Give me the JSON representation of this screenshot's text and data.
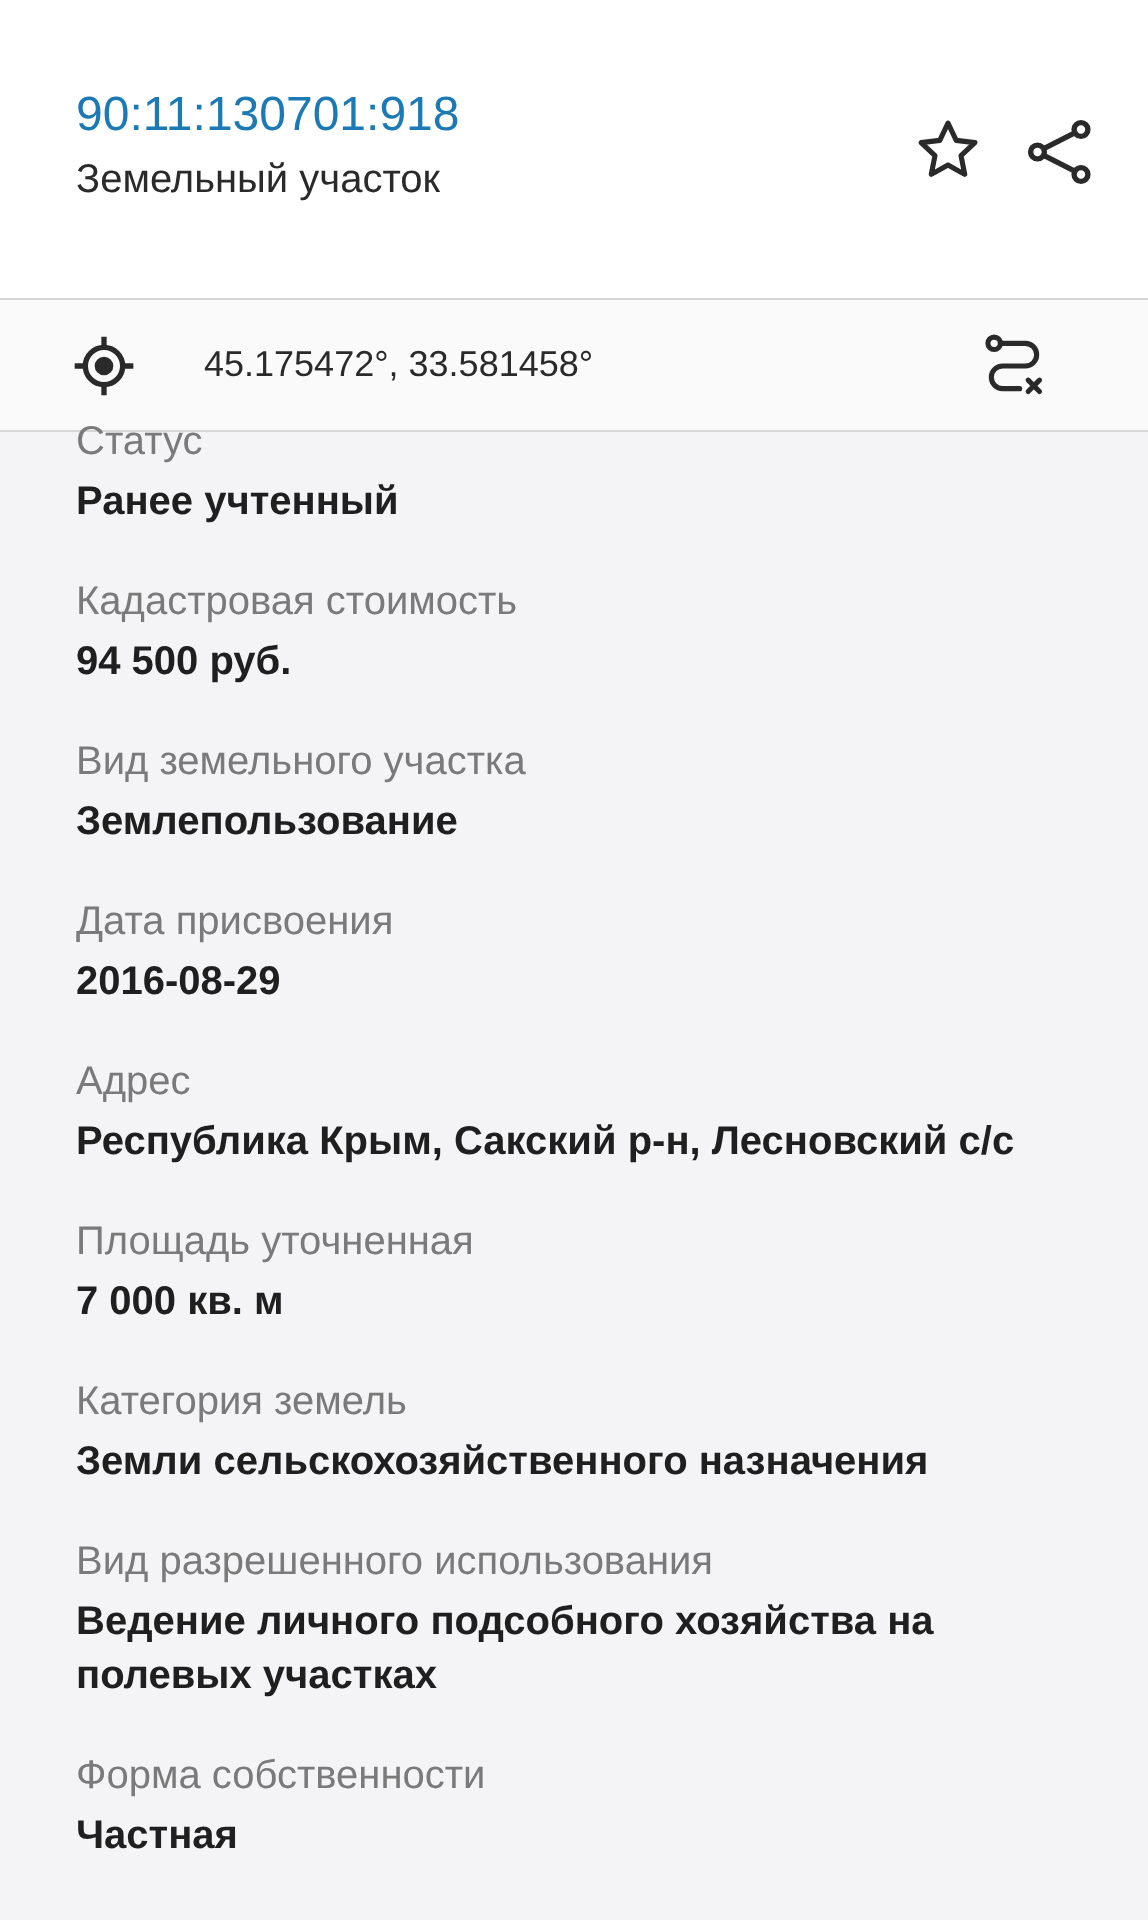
{
  "header": {
    "cadastral_number": "90:11:130701:918",
    "object_type": "Земельный участок"
  },
  "coordinates": "45.175472°, 33.581458°",
  "fields": [
    {
      "label": "Статус",
      "value": "Ранее учтенный"
    },
    {
      "label": "Кадастровая стоимость",
      "value": "94 500 руб."
    },
    {
      "label": "Вид земельного участка",
      "value": "Землепользование"
    },
    {
      "label": "Дата присвоения",
      "value": "2016-08-29"
    },
    {
      "label": "Адрес",
      "value": "Республика Крым, Сакский р-н, Лесновский с/с"
    },
    {
      "label": "Площадь уточненная",
      "value": "7 000 кв. м"
    },
    {
      "label": "Категория земель",
      "value": "Земли сельскохозяйственного назначения"
    },
    {
      "label": "Вид разрешенного использования",
      "value": "Ведение личного подсобного хозяйства на полевых участках"
    },
    {
      "label": "Форма собственности",
      "value": "Частная"
    }
  ]
}
